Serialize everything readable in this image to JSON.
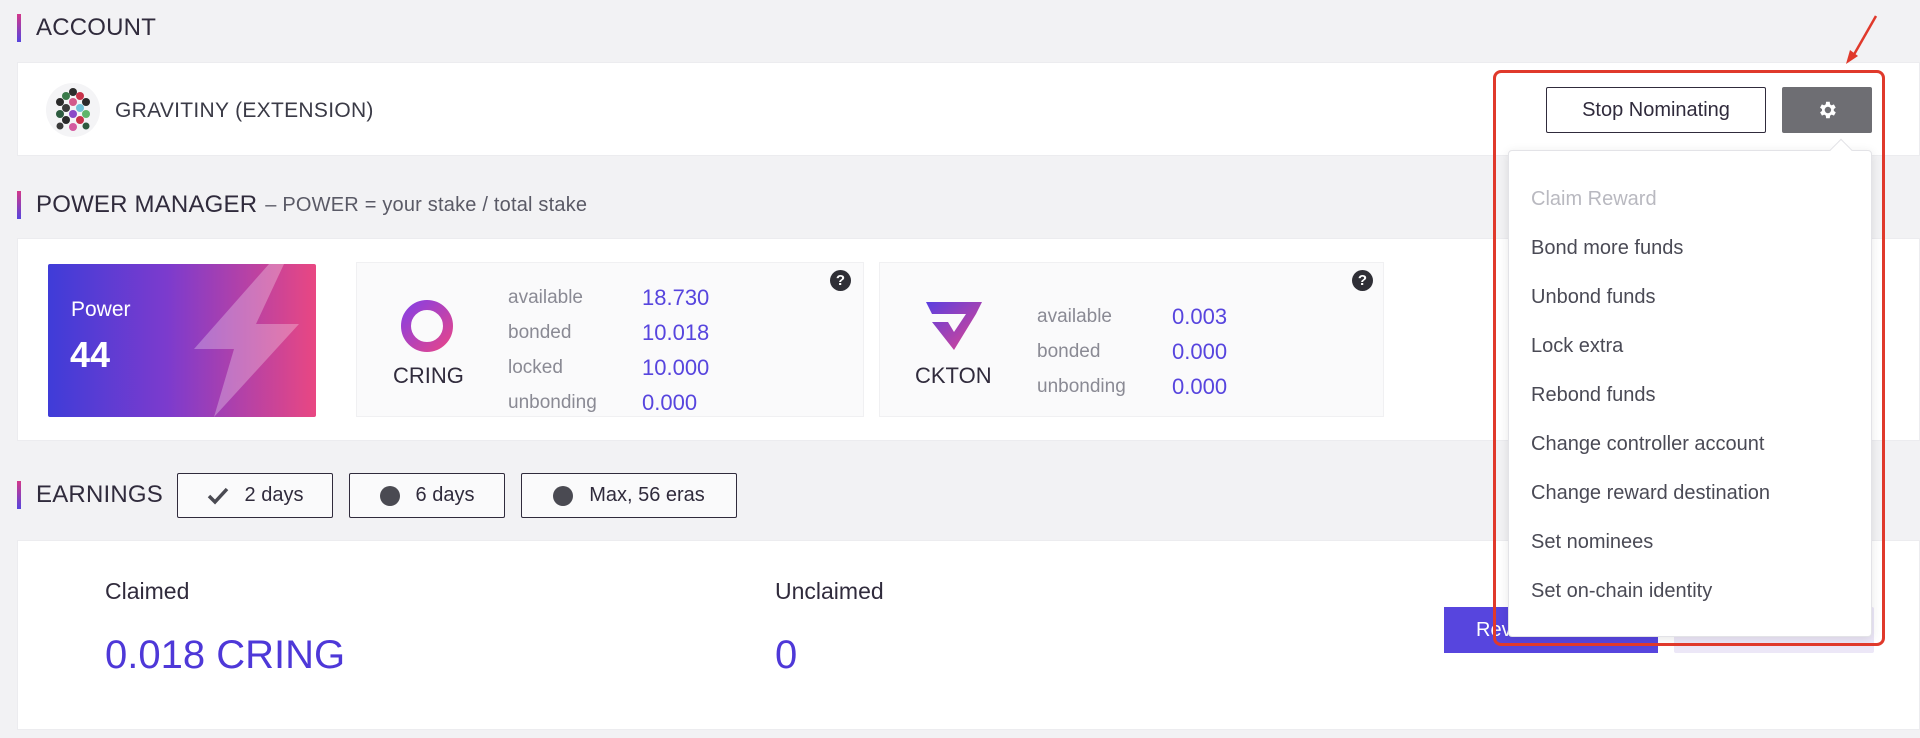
{
  "account": {
    "section_title": "ACCOUNT",
    "name": "GRAVITINY (EXTENSION)",
    "stop_button": "Stop Nominating",
    "settings_icon": "gear-icon"
  },
  "power_manager": {
    "section_title": "POWER MANAGER",
    "subtitle": "– POWER = your stake / total stake",
    "power_label": "Power",
    "power_value": "44",
    "cring": {
      "name": "CRING",
      "rows": [
        {
          "label": "available",
          "value": "18.730"
        },
        {
          "label": "bonded",
          "value": "10.018"
        },
        {
          "label": "locked",
          "value": "10.000"
        },
        {
          "label": "unbonding",
          "value": "0.000"
        }
      ],
      "help": "?"
    },
    "ckton": {
      "name": "CKTON",
      "rows": [
        {
          "label": "available",
          "value": "0.003"
        },
        {
          "label": "bonded",
          "value": "0.000"
        },
        {
          "label": "unbonding",
          "value": "0.000"
        }
      ],
      "help": "?"
    }
  },
  "earnings": {
    "section_title": "EARNINGS",
    "filters": [
      {
        "label": "2 days",
        "selected": true
      },
      {
        "label": "6 days",
        "selected": false
      },
      {
        "label": "Max, 56 eras",
        "selected": false
      }
    ],
    "claimed_label": "Claimed",
    "claimed_value": "0.018 CRING",
    "unclaimed_label": "Unclaimed",
    "unclaimed_value": "0",
    "reward_button": "Rev"
  },
  "dropdown": {
    "items": [
      {
        "label": "Claim Reward",
        "disabled": true
      },
      {
        "label": "Bond more funds",
        "disabled": false
      },
      {
        "label": "Unbond funds",
        "disabled": false
      },
      {
        "label": "Lock extra",
        "disabled": false
      },
      {
        "label": "Rebond funds",
        "disabled": false
      },
      {
        "label": "Change controller account",
        "disabled": false
      },
      {
        "label": "Change reward destination",
        "disabled": false
      },
      {
        "label": "Set nominees",
        "disabled": false
      },
      {
        "label": "Set on-chain identity",
        "disabled": false
      }
    ]
  },
  "colors": {
    "accent": "#5745de",
    "highlight": "#e0392b",
    "power_gradient_start": "#3f3cd8",
    "power_gradient_end": "#e94782"
  }
}
